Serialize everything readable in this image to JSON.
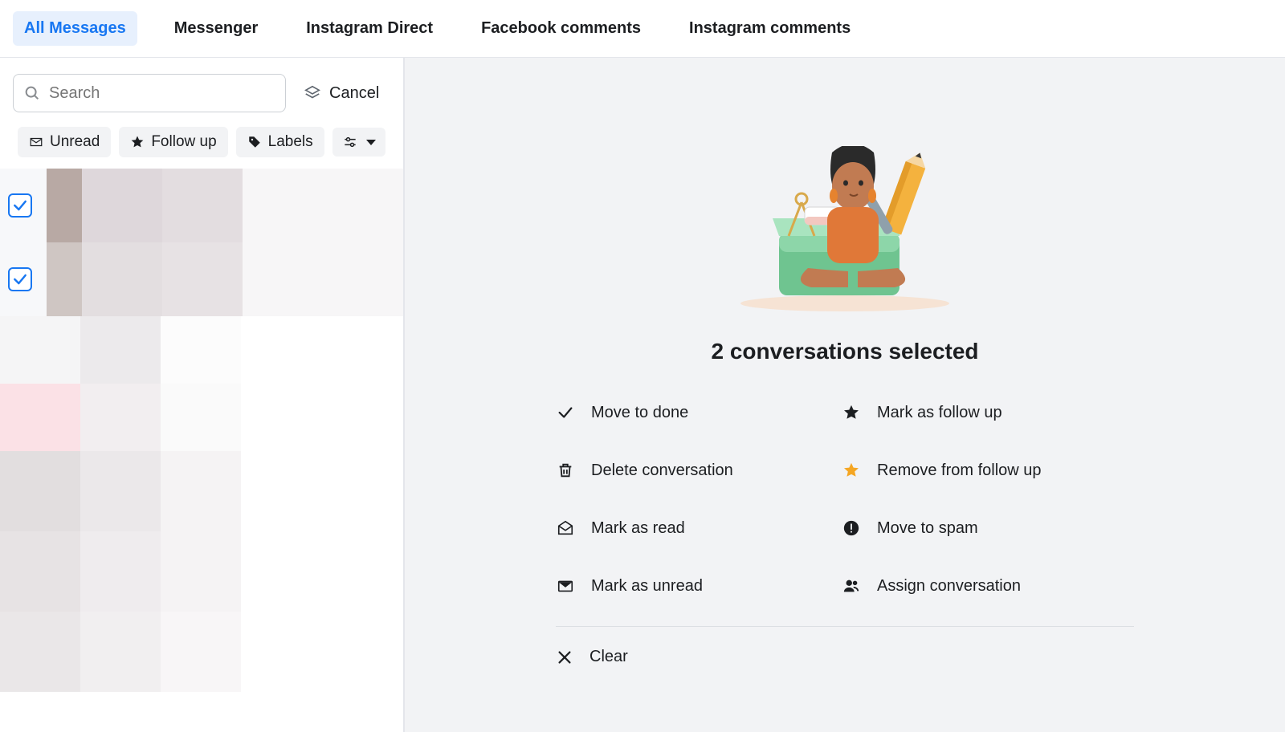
{
  "tabs": {
    "items": [
      {
        "label": "All Messages",
        "active": true
      },
      {
        "label": "Messenger",
        "active": false
      },
      {
        "label": "Instagram Direct",
        "active": false
      },
      {
        "label": "Facebook comments",
        "active": false
      },
      {
        "label": "Instagram comments",
        "active": false
      }
    ]
  },
  "search": {
    "placeholder": "Search",
    "value": ""
  },
  "cancel_label": "Cancel",
  "filters": {
    "unread": "Unread",
    "followup": "Follow up",
    "labels": "Labels"
  },
  "selection": {
    "title": "2 conversations selected"
  },
  "actions": {
    "move_done": "Move to done",
    "mark_followup": "Mark as follow up",
    "delete": "Delete conversation",
    "remove_followup": "Remove from follow up",
    "mark_read": "Mark as read",
    "move_spam": "Move to spam",
    "mark_unread": "Mark as unread",
    "assign": "Assign conversation",
    "clear": "Clear"
  },
  "icons": {
    "search": "search-icon",
    "cancel_stack": "stack-icon",
    "unread": "envelope-icon",
    "star": "star-icon",
    "tag": "tag-icon",
    "sliders": "sliders-icon",
    "check": "check-icon",
    "trash": "trash-icon",
    "read": "mark-read-icon",
    "closed_envelope": "closed-envelope-icon",
    "star_filled": "star-filled-icon",
    "star_orange": "star-orange-icon",
    "alert": "alert-circle-icon",
    "people": "people-icon",
    "close": "close-icon"
  }
}
